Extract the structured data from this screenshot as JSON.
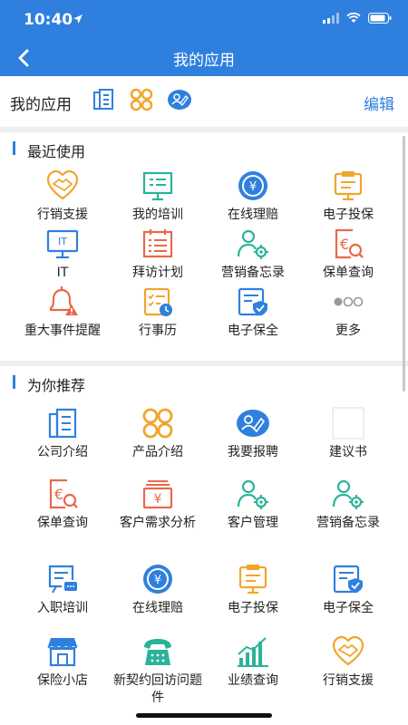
{
  "status": {
    "time": "10:40"
  },
  "nav": {
    "title": "我的应用"
  },
  "my_apps": {
    "label": "我的应用",
    "edit": "编辑"
  },
  "recent": {
    "title": "最近使用",
    "items": [
      {
        "label": "行销支援",
        "icon": "handshake-icon"
      },
      {
        "label": "我的培训",
        "icon": "training-board-icon"
      },
      {
        "label": "在线理赔",
        "icon": "claims-coin-icon"
      },
      {
        "label": "电子投保",
        "icon": "clipboard-monitor-icon"
      },
      {
        "label": "IT",
        "icon": "it-monitor-icon"
      },
      {
        "label": "拜访计划",
        "icon": "visit-plan-icon"
      },
      {
        "label": "营销备忘录",
        "icon": "users-gear-icon"
      },
      {
        "label": "保单查询",
        "icon": "policy-search-icon"
      },
      {
        "label": "重大事件提醒",
        "icon": "alarm-bell-icon"
      },
      {
        "label": "行事历",
        "icon": "calendar-checklist-icon"
      },
      {
        "label": "电子保全",
        "icon": "doc-shield-icon"
      },
      {
        "label": "更多",
        "icon": "more-dots-icon"
      }
    ]
  },
  "recommend": {
    "title": "为你推荐",
    "items": [
      {
        "label": "公司介绍",
        "icon": "building-doc-icon"
      },
      {
        "label": "产品介绍",
        "icon": "four-rings-icon"
      },
      {
        "label": "我要报聘",
        "icon": "apply-pen-icon"
      },
      {
        "label": "建议书",
        "icon": "blank-square-icon"
      },
      {
        "label": "保单查询",
        "icon": "policy-search-icon"
      },
      {
        "label": "客户需求分析",
        "icon": "yen-box-icon"
      },
      {
        "label": "客户管理",
        "icon": "users-gear-icon"
      },
      {
        "label": "营销备忘录",
        "icon": "users-gear-icon"
      },
      {
        "label": "入职培训",
        "icon": "onboard-board-icon"
      },
      {
        "label": "在线理赔",
        "icon": "claims-coin-icon"
      },
      {
        "label": "电子投保",
        "icon": "clipboard-monitor-icon"
      },
      {
        "label": "电子保全",
        "icon": "doc-shield-icon"
      },
      {
        "label": "保险小店",
        "icon": "shop-icon"
      },
      {
        "label": "新契约回访问题件",
        "icon": "telephone-icon"
      },
      {
        "label": "业绩查询",
        "icon": "bar-chart-icon"
      },
      {
        "label": "行销支援",
        "icon": "handshake-icon"
      }
    ]
  }
}
